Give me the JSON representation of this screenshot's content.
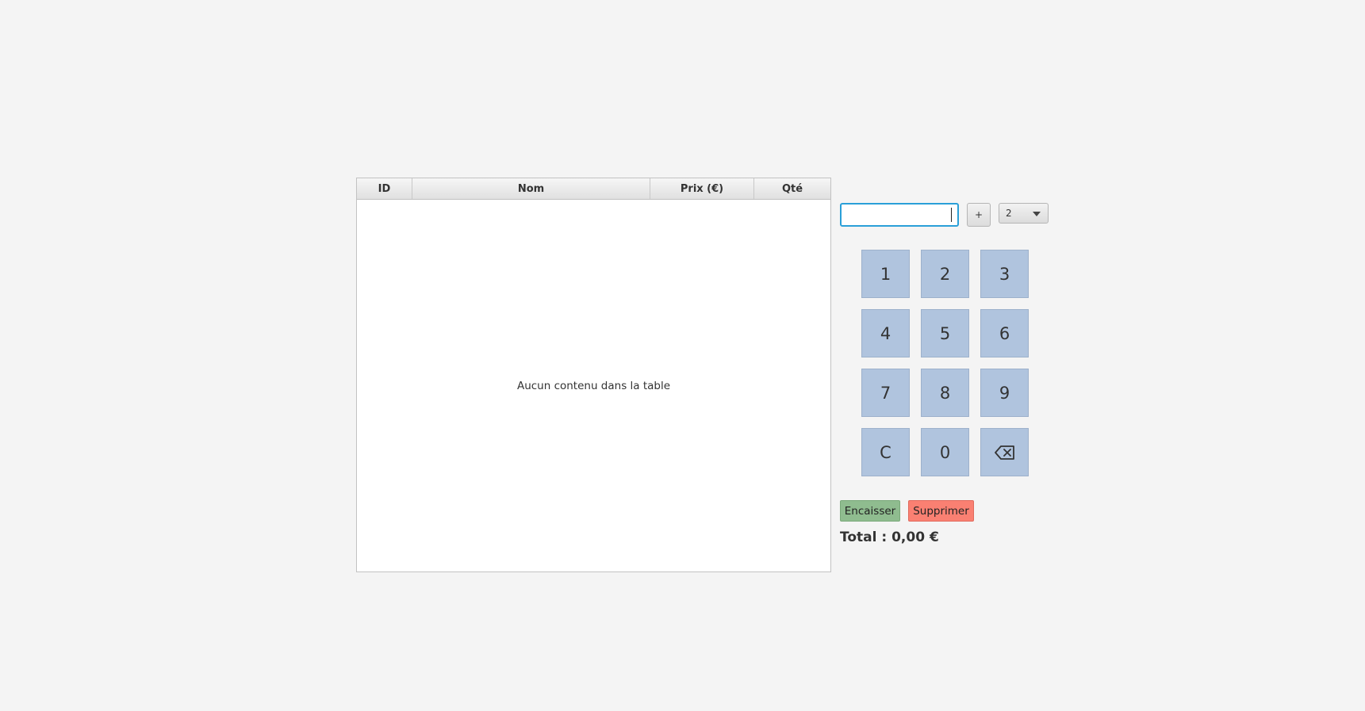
{
  "table": {
    "columns": [
      "ID",
      "Nom",
      "Prix (€)",
      "Qté"
    ],
    "empty_message": "Aucun contenu dans la table"
  },
  "entry": {
    "input_value": "",
    "plus_label": "+",
    "select_value": "2"
  },
  "keypad": {
    "keys": [
      "1",
      "2",
      "3",
      "4",
      "5",
      "6",
      "7",
      "8",
      "9",
      "C",
      "0",
      "⌫"
    ],
    "backspace_icon": "backspace-icon",
    "key_color": "#b0c4de"
  },
  "actions": {
    "encaisser_label": "Encaisser",
    "encaisser_color": "#8fbc8f",
    "supprimer_label": "Supprimer",
    "supprimer_color": "#fa8072"
  },
  "total_label": "Total : 0,00 €"
}
